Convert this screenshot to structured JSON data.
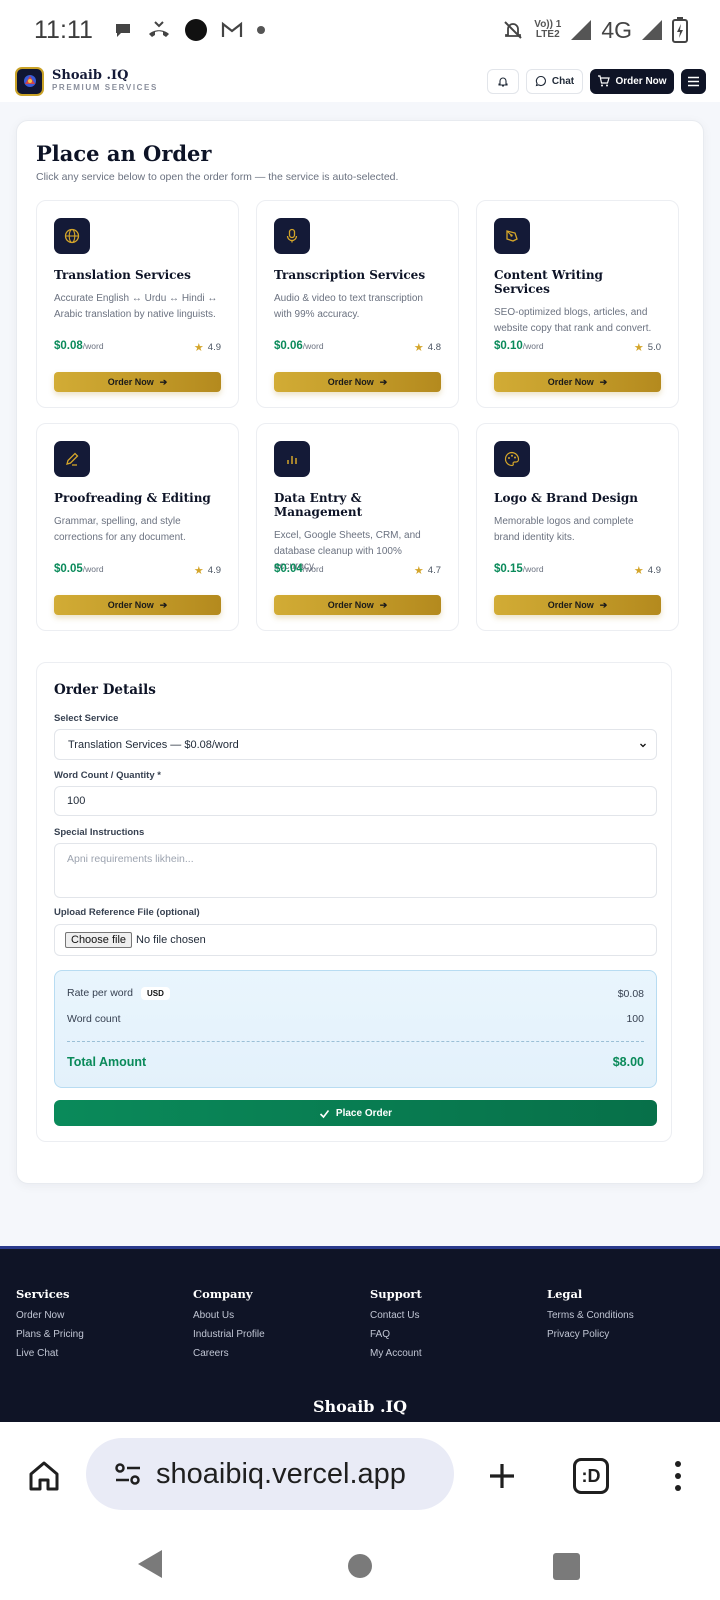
{
  "status_bar": {
    "time": "11:11",
    "network": "4G",
    "volte_top": "Vo)) 1",
    "volte_bottom": "LTE2"
  },
  "header": {
    "brand_name": "Shoaib .IQ",
    "brand_tagline": "PREMIUM SERVICES",
    "chat_label": "Chat",
    "order_now_label": "Order Now"
  },
  "page": {
    "title": "Place an Order",
    "subtitle": "Click any service below to open the order form — the service is auto-selected."
  },
  "services": [
    {
      "name": "Translation Services",
      "desc": "Accurate English ↔ Urdu ↔ Hindi ↔ Arabic translation by native linguists.",
      "price": "$0.08",
      "unit": "/word",
      "rating": "4.9",
      "button": "Order Now",
      "icon": "globe-icon"
    },
    {
      "name": "Transcription Services",
      "desc": "Audio & video to text transcription with 99% accuracy.",
      "price": "$0.06",
      "unit": "/word",
      "rating": "4.8",
      "button": "Order Now",
      "icon": "microphone-icon"
    },
    {
      "name": "Content Writing Services",
      "desc": "SEO-optimized blogs, articles, and website copy that rank and convert.",
      "price": "$0.10",
      "unit": "/word",
      "rating": "5.0",
      "button": "Order Now",
      "icon": "pen-tool-icon"
    },
    {
      "name": "Proofreading & Editing",
      "desc": "Grammar, spelling, and style corrections for any document.",
      "price": "$0.05",
      "unit": "/word",
      "rating": "4.9",
      "button": "Order Now",
      "icon": "pencil-icon"
    },
    {
      "name": "Data Entry & Management",
      "desc": "Excel, Google Sheets, CRM, and database cleanup with 100% accuracy.",
      "price": "$0.04",
      "unit": "/word",
      "rating": "4.7",
      "button": "Order Now",
      "icon": "bar-chart-icon"
    },
    {
      "name": "Logo & Brand Design",
      "desc": "Memorable logos and complete brand identity kits.",
      "price": "$0.15",
      "unit": "/word",
      "rating": "4.9",
      "button": "Order Now",
      "icon": "palette-icon"
    }
  ],
  "order_form": {
    "title": "Order Details",
    "select_label": "Select Service",
    "select_value": "Translation Services — $0.08/word",
    "count_label": "Word Count / Quantity *",
    "count_value": "100",
    "instructions_label": "Special Instructions",
    "instructions_placeholder": "Apni requirements likhein...",
    "upload_label": "Upload Reference File (optional)",
    "file_button": "Choose file",
    "file_status": "No file chosen",
    "rate_label": "Rate per word",
    "currency_badge": "USD",
    "rate_value": "$0.08",
    "wordcount_label": "Word count",
    "wordcount_value": "100",
    "total_label": "Total Amount",
    "total_value": "$8.00",
    "submit_label": "Place Order"
  },
  "footer": {
    "columns": [
      {
        "heading": "Services",
        "links": [
          "Order Now",
          "Plans & Pricing",
          "Live Chat"
        ]
      },
      {
        "heading": "Company",
        "links": [
          "About Us",
          "Industrial Profile",
          "Careers"
        ]
      },
      {
        "heading": "Support",
        "links": [
          "Contact Us",
          "FAQ",
          "My Account"
        ]
      },
      {
        "heading": "Legal",
        "links": [
          "Terms & Conditions",
          "Privacy Policy"
        ]
      }
    ],
    "brand": "Shoaib .IQ"
  },
  "browser": {
    "url": "shoaibiq.vercel.app",
    "tabs_label": ":D"
  },
  "colors": {
    "brand_navy": "#0f1426",
    "gold": "#c9a227",
    "green": "#0a8a5a"
  }
}
